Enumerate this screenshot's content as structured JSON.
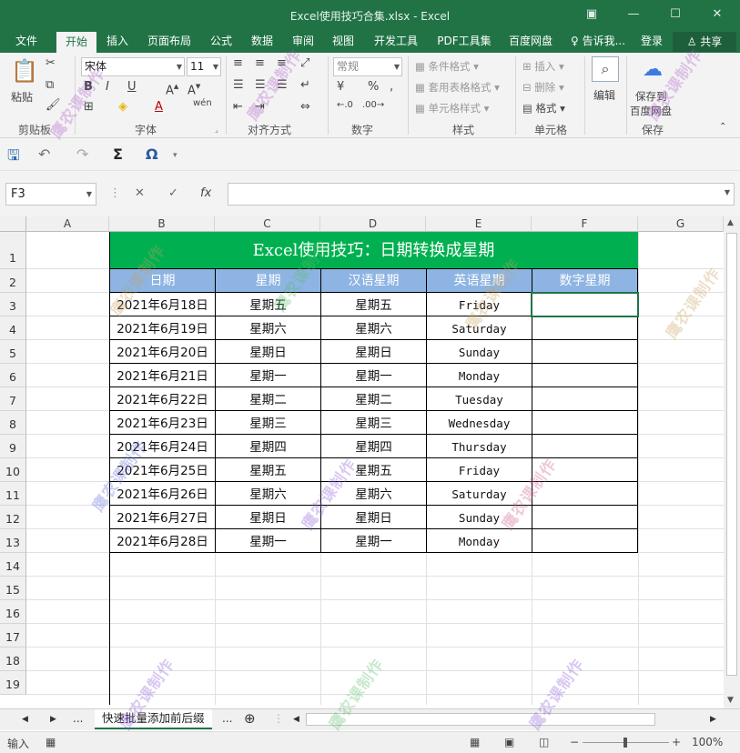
{
  "window": {
    "title": "Excel使用技巧合集.xlsx - Excel"
  },
  "tabs": [
    "文件",
    "开始",
    "插入",
    "页面布局",
    "公式",
    "数据",
    "审阅",
    "视图",
    "开发工具",
    "PDF工具集",
    "百度网盘",
    "告诉我...",
    "登录"
  ],
  "share_label": "共享",
  "ribbon": {
    "paste_label": "粘贴",
    "font_name": "宋体",
    "font_size": "11",
    "number_format": "常规",
    "conditional_format": "条件格式",
    "table_format": "套用表格格式",
    "cell_style": "单元格样式",
    "insert": "插入",
    "delete": "删除",
    "format": "格式",
    "edit": "编辑",
    "save_to_baidu": "保存到",
    "save_to_baidu2": "百度网盘",
    "groups": [
      "剪贴板",
      "字体",
      "对齐方式",
      "数字",
      "样式",
      "单元格",
      "保存"
    ]
  },
  "formula_bar": {
    "name_box": "F3",
    "fx": "fx",
    "formula": ""
  },
  "columns": [
    "A",
    "B",
    "C",
    "D",
    "E",
    "F",
    "G"
  ],
  "rows": [
    "1",
    "2",
    "3",
    "4",
    "5",
    "6",
    "7",
    "8",
    "9",
    "10",
    "11",
    "12",
    "13",
    "14",
    "15",
    "16",
    "17",
    "18",
    "19"
  ],
  "sheet": {
    "title": "Excel使用技巧：日期转换成星期",
    "headers": [
      "日期",
      "星期",
      "汉语星期",
      "英语星期",
      "数字星期"
    ],
    "data": [
      [
        "2021年6月18日",
        "星期五",
        "星期五",
        "Friday",
        ""
      ],
      [
        "2021年6月19日",
        "星期六",
        "星期六",
        "Saturday",
        ""
      ],
      [
        "2021年6月20日",
        "星期日",
        "星期日",
        "Sunday",
        ""
      ],
      [
        "2021年6月21日",
        "星期一",
        "星期一",
        "Monday",
        ""
      ],
      [
        "2021年6月22日",
        "星期二",
        "星期二",
        "Tuesday",
        ""
      ],
      [
        "2021年6月23日",
        "星期三",
        "星期三",
        "Wednesday",
        ""
      ],
      [
        "2021年6月24日",
        "星期四",
        "星期四",
        "Thursday",
        ""
      ],
      [
        "2021年6月25日",
        "星期五",
        "星期五",
        "Friday",
        ""
      ],
      [
        "2021年6月26日",
        "星期六",
        "星期六",
        "Saturday",
        ""
      ],
      [
        "2021年6月27日",
        "星期日",
        "星期日",
        "Sunday",
        ""
      ],
      [
        "2021年6月28日",
        "星期一",
        "星期一",
        "Monday",
        ""
      ]
    ]
  },
  "sheet_tabs": {
    "active": "快速批量添加前后缀",
    "more": "...",
    "ellipsis": "..."
  },
  "status": {
    "mode": "输入",
    "zoom": "100%"
  },
  "watermark_text": "鹰农课制作",
  "colors": {
    "accent": "#217346",
    "title_fill": "#00b050",
    "header_fill": "#8db4e2"
  }
}
